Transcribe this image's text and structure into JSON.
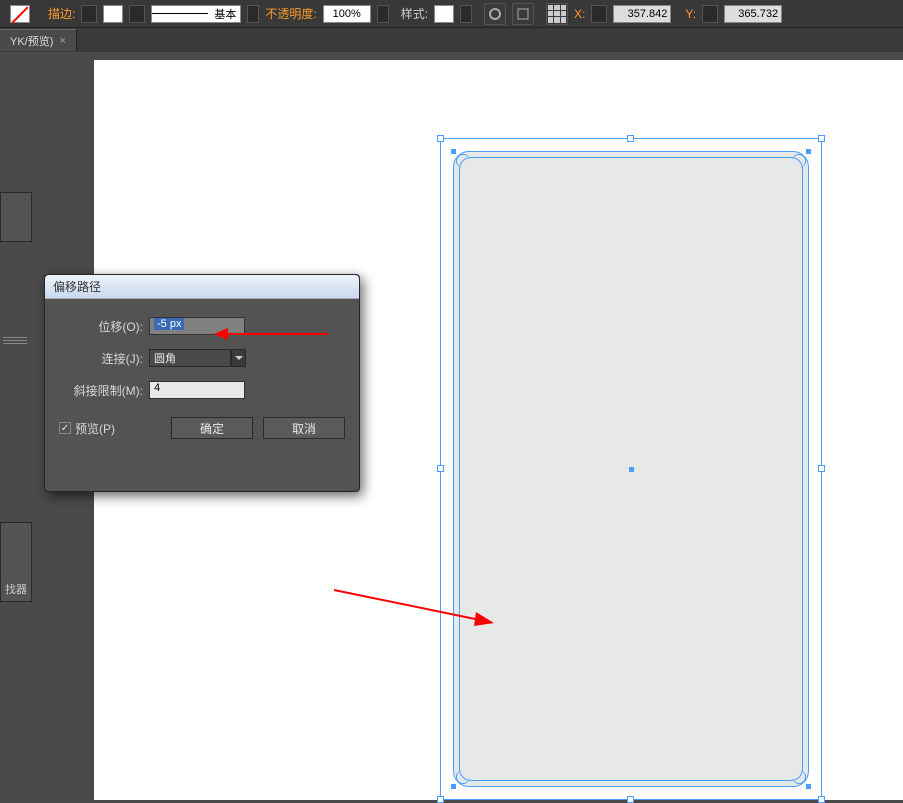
{
  "topbar": {
    "stroke_label": "描边:",
    "stroke_preset": "基本",
    "opacity_label": "不透明度:",
    "opacity_value": "100%",
    "style_label": "样式:",
    "x_label": "X:",
    "x_value": "357.842",
    "y_label": "Y:",
    "y_value": "365.732"
  },
  "tab": {
    "title": "YK/预览)",
    "close": "×"
  },
  "sidepanel2_label": "找器",
  "dialog": {
    "title": "偏移路径",
    "offset_label": "位移(O):",
    "offset_value": "-5 px",
    "join_label": "连接(J):",
    "join_value": "圆角",
    "miter_label": "斜接限制(M):",
    "miter_value": "4",
    "preview_label": "预览(P)",
    "ok": "确定",
    "cancel": "取消"
  }
}
